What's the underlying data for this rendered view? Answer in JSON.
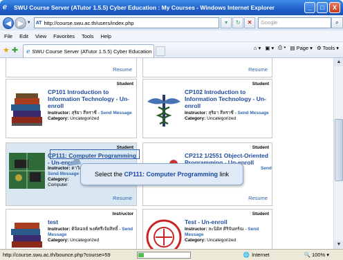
{
  "window": {
    "title": "SWU Course Server (ATutor 1.5.5) Cyber Education : My Courses - Windows Internet Explorer",
    "buttons": [
      "_",
      "□",
      "X"
    ]
  },
  "address": {
    "url": "http://course.swu.ac.th/users/index.php",
    "search_placeholder": "Google"
  },
  "menu": [
    "File",
    "Edit",
    "View",
    "Favorites",
    "Tools",
    "Help"
  ],
  "tab": {
    "label": "SWU Course Server (ATutor 1.5.5) Cyber Education :..."
  },
  "command_bar": {
    "page": "Page",
    "tools": "Tools"
  },
  "courses": [
    {
      "role": "",
      "resume": "Resume"
    },
    {
      "role": "",
      "resume": "Resume"
    },
    {
      "role": "Student",
      "title": "CP101 Introduction to Information Technology - Un-enroll",
      "instructor_label": "Instructor:",
      "instructor": "สุริยา สีหราชี",
      "send": "Send Message",
      "category_label": "Category:",
      "category": "Uncategorized"
    },
    {
      "role": "Student",
      "title": "CP102 Introduction to Information Technology - Un-enroll",
      "instructor_label": "Instructor:",
      "instructor": "สุริยา สีหราชี",
      "send": "Send Message",
      "category_label": "Category:",
      "category": "Uncategorized"
    },
    {
      "role": "Student",
      "title": "CP111: Computer Programming - Un-enroll",
      "instructor_label": "Instructor:",
      "instructor": "ดาวิณ ช",
      "send": "Send Message",
      "category_label": "Category:",
      "category": "Computer",
      "resume": "Resume"
    },
    {
      "role": "Student",
      "title": "CP212 1/2551 Object-Oriented Programming - Un-enroll",
      "send": "Send",
      "resume": "Resume"
    },
    {
      "role": "Instructor",
      "title": "test",
      "instructor_label": "Instructor:",
      "instructor": "ดิจิตอลธ์ พงศ์ศรีเจ้ยสิทธิ์",
      "send": "Send Message",
      "category_label": "Category:",
      "category": "Uncategorized"
    },
    {
      "role": "Student",
      "title": "Test - Un-enroll",
      "instructor_label": "Instructor:",
      "instructor": "ละนิยิส ศิริจันทร์ณ",
      "send": "Send Message",
      "category_label": "Category:",
      "category": "Uncategorized"
    }
  ],
  "callout": {
    "prefix": "Select the",
    "target": "CP111: Computer Programming",
    "suffix": "link"
  },
  "status": {
    "url": "http://course.swu.ac.th/bounce.php?course=59",
    "zone": "Internet",
    "zoom": "100%",
    "progress": 0.1
  },
  "colors": {
    "link": "#214c9c",
    "highlight": "#d9e7f2",
    "titlebar": "#1f5fc9"
  }
}
